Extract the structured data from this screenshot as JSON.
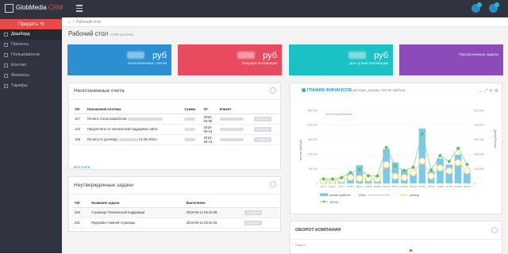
{
  "app": {
    "brand": "GlobMedia",
    "brand_suffix": "CRM"
  },
  "sidebar": {
    "sale_button": "Продать",
    "items": [
      {
        "label": "Дашборд",
        "active": true
      },
      {
        "label": "Проекты"
      },
      {
        "label": "Пользователи"
      },
      {
        "label": "Контакт"
      },
      {
        "label": "Финансы"
      },
      {
        "label": "Тарифы"
      }
    ]
  },
  "breadcrumb": {
    "current": "Рабочий стол"
  },
  "page": {
    "title": "Рабочий стол",
    "subtitle": "CRM система"
  },
  "tiles": [
    {
      "value": "руб",
      "label": "Неоплаченных счетов",
      "color": "#2b8fd1"
    },
    {
      "value": "руб",
      "label": "Текущие мотивации",
      "color": "#e84a5f"
    },
    {
      "value": "руб",
      "label": "Доступная мотивация",
      "color": "#1bc2c5"
    },
    {
      "value": "",
      "label": "Просроченные задачи",
      "color": "#8c4bb8"
    }
  ],
  "invoices": {
    "title": "Неоплаченные счета",
    "columns": [
      "#ID",
      "Назначение платежа",
      "Сумма",
      "От",
      "Клиент",
      ""
    ],
    "rows": [
      {
        "id": "117",
        "purpose": "Оплата этапа разработки",
        "from1": "2018-",
        "from2": "03-05",
        "action": "Оплачено"
      },
      {
        "id": "122",
        "purpose": "Предоплата по технической поддержки сайта",
        "from1": "2018-",
        "from2": "06-13",
        "action": "Оплачено"
      },
      {
        "id": "126",
        "purpose": "Оплата по договору",
        "purpose_tail": "13.06.2018 г.",
        "from1": "2018-",
        "from2": "06-13",
        "action": "Оплачено"
      }
    ],
    "all_link": "Все счета"
  },
  "tasks": {
    "title": "Неутвержденные задачи",
    "columns": [
      "#ID",
      "Название задачи",
      "Выполнена",
      ""
    ],
    "rows": [
      {
        "id": "284",
        "name": "Страница Технической поддержки",
        "done": "2018-06-14 05:43:36",
        "action": "Утвердить"
      },
      {
        "id": "261",
        "name": "Редизайн главной страницы",
        "done": "2018-06-14 05:42:45",
        "action": "Утвердить"
      }
    ]
  },
  "finance_chart": {
    "title": "ГРАФИК ФИНАНСОВ",
    "subtitle": "расходы, доходы, чистая прибыль",
    "legend_top": "За последний месяц",
    "y_left_title": "чистая прибыль",
    "y_right_title": "Доход/Расход"
  },
  "chart_data": {
    "type": "bar",
    "categories": [
      "АВГ17",
      "СЕН17",
      "ОКТ17",
      "НОЯ17",
      "ДЕК17",
      "ЯНВ18",
      "ФЕВ18",
      "МАР18",
      "АПР18",
      "МАЙ18",
      "ИЮН17",
      "ИЮЛ17",
      "АВГ18",
      "СЕН18",
      "ОКТ18",
      "НОЯ18",
      "ДЕК18"
    ],
    "ylim_left": [
      0,
      250000
    ],
    "ylim_right": [
      0,
      500000
    ],
    "left_ticks": [
      "250,000",
      "200,000",
      "150,000",
      "100,000",
      "50,000",
      "0"
    ],
    "right_ticks": [
      "500,000",
      "400,000",
      "300,000",
      "200,000",
      "100,000",
      "0"
    ],
    "series": [
      {
        "name": "чистая прибыль",
        "color": "#7ec8e8",
        "values": [
          15000,
          10000,
          12000,
          35000,
          62000,
          18000,
          20000,
          118000,
          72000,
          46000,
          38000,
          188000,
          42000,
          85000,
          64000,
          98000,
          44000
        ]
      },
      {
        "name": "доход",
        "color": "#5fc45f",
        "values": [
          30000,
          28000,
          38000,
          75000,
          95000,
          52000,
          50000,
          245000,
          120000,
          88000,
          110000,
          340000,
          92000,
          190000,
          150000,
          240000,
          130000
        ]
      },
      {
        "name": "расход",
        "color": "#f2d27a",
        "values": [
          16000,
          20000,
          25000,
          40000,
          34000,
          34000,
          30000,
          128000,
          48000,
          40000,
          72000,
          152000,
          50000,
          105000,
          86000,
          142000,
          86000
        ]
      }
    ],
    "legend": [
      "чистая прибыль",
      "Итого",
      "расход",
      "доход"
    ]
  },
  "turnover": {
    "title": "ОБОРОТ КОМПАНИИ",
    "axis_label": "Оборот"
  },
  "colors": {
    "accent": "#2b89c8",
    "topbar": "#2f3440",
    "danger": "#e84a4a"
  }
}
